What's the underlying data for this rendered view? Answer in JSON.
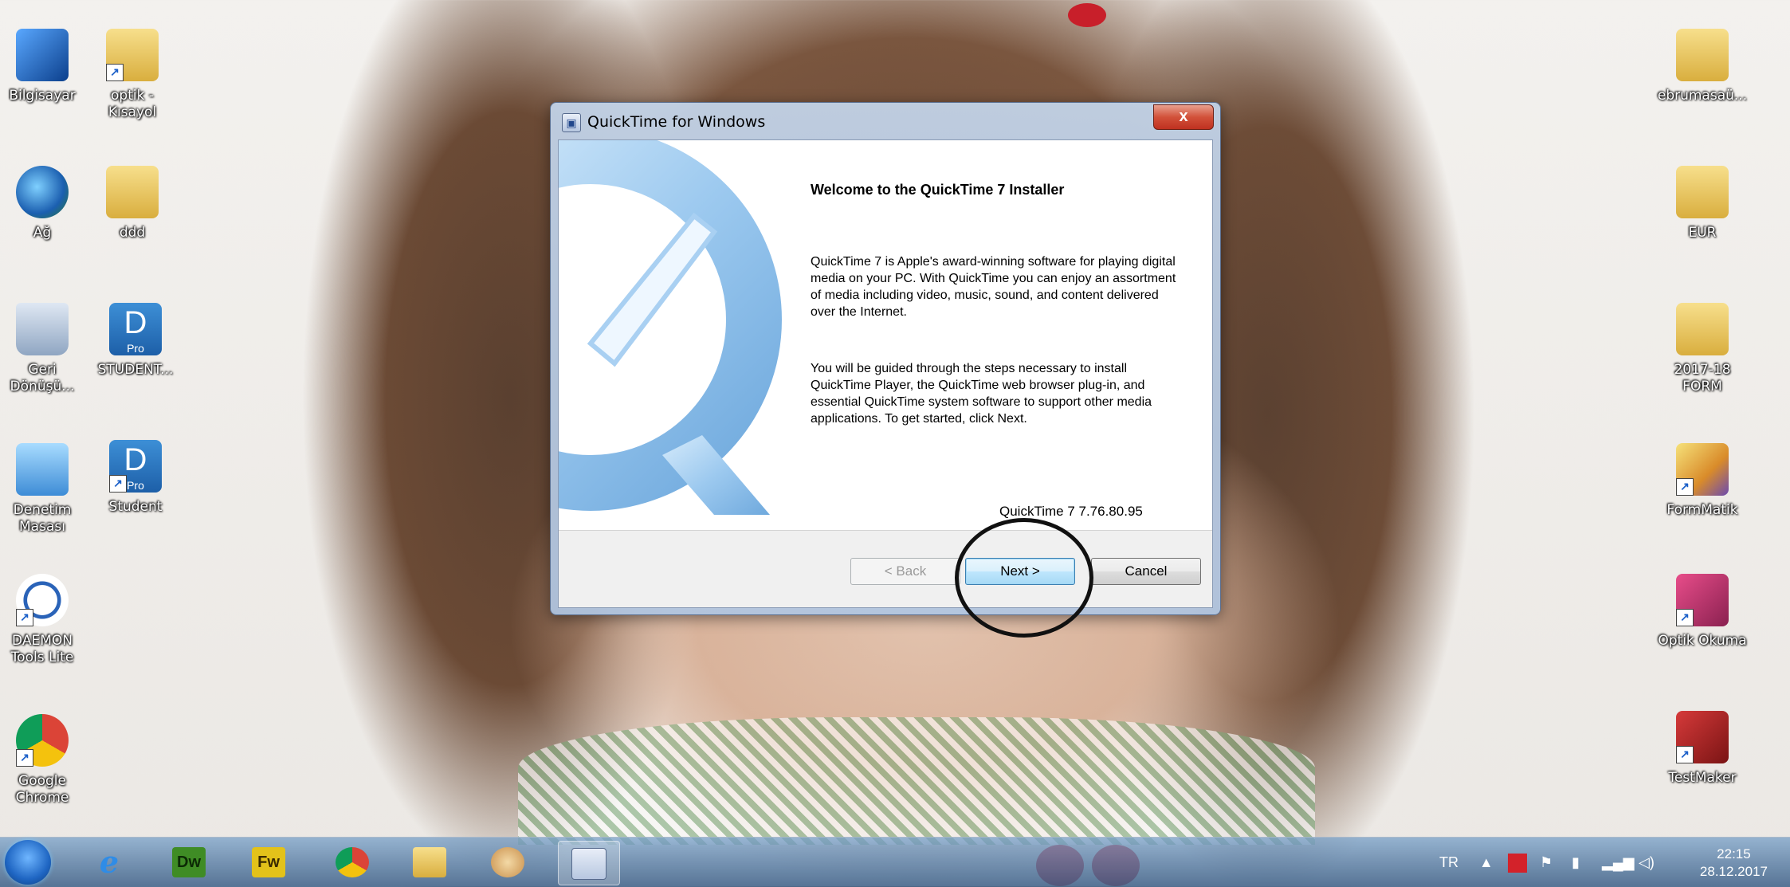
{
  "desktop": {
    "left_icons": [
      {
        "label": "Bilgisayar"
      },
      {
        "label": "optik -\nKısayol"
      },
      {
        "label": "Ağ"
      },
      {
        "label": "ddd"
      },
      {
        "label": "Geri\nDönüşü..."
      },
      {
        "label": "STUDENT...",
        "badge": "Pro"
      },
      {
        "label": "Denetim\nMasası"
      },
      {
        "label": "Student",
        "badge": "Pro"
      },
      {
        "label": "DAEMON\nTools Lite"
      },
      {
        "label": "Google\nChrome"
      }
    ],
    "right_icons": [
      {
        "label": "ebrumasaü..."
      },
      {
        "label": "EUR"
      },
      {
        "label": "2017-18\nFORM"
      },
      {
        "label": "FormMatik"
      },
      {
        "label": "Optik Okuma"
      },
      {
        "label": "TestMaker"
      }
    ]
  },
  "window": {
    "title": "QuickTime for Windows",
    "close_label": "x",
    "heading": "Welcome to the QuickTime 7 Installer",
    "para1": "QuickTime 7 is Apple's award-winning software for playing digital media on your PC. With QuickTime you can enjoy an assortment of media including video, music, sound, and content delivered over the Internet.",
    "para2": "You will be guided through the steps necessary to install QuickTime Player, the QuickTime web browser plug-in, and essential QuickTime system software to support other media applications. To get started, click Next.",
    "version": "QuickTime 7 7.76.80.95",
    "buttons": {
      "back": "< Back",
      "next": "Next >",
      "cancel": "Cancel"
    }
  },
  "taskbar": {
    "apps": [
      {
        "name": "Dw"
      },
      {
        "name": "Fw"
      }
    ],
    "tray": {
      "language": "TR",
      "time": "22:15",
      "date": "28.12.2017"
    }
  },
  "colors": {
    "close_red": "#c8402b",
    "default_button": "#bee6fd",
    "dw_green": "#3f8c25",
    "fw_yellow": "#e3c21a"
  }
}
